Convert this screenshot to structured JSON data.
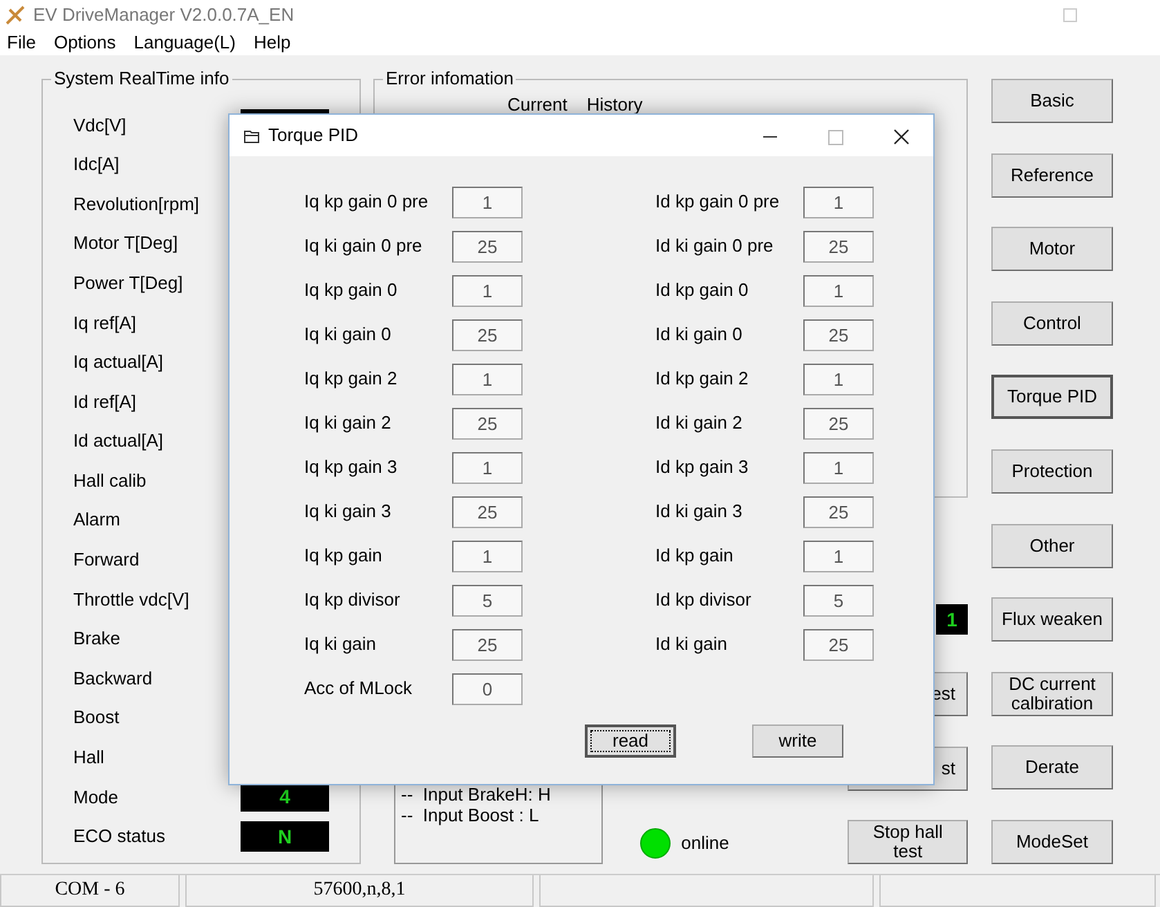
{
  "window": {
    "title": "EV DriveManager V2.0.0.7A_EN"
  },
  "menu": [
    "File",
    "Options",
    "Language(L)",
    "Help"
  ],
  "realtime": {
    "title": "System RealTime info",
    "items": [
      {
        "label": "Vdc[V]",
        "kind": "display"
      },
      {
        "label": "Idc[A]",
        "kind": "plain"
      },
      {
        "label": "Revolution[rpm]",
        "kind": "plain"
      },
      {
        "label": "Motor T[Deg]",
        "kind": "plain"
      },
      {
        "label": "Power T[Deg]",
        "kind": "plain"
      },
      {
        "label": "Iq ref[A]",
        "kind": "plain"
      },
      {
        "label": "Iq actual[A]",
        "kind": "plain"
      },
      {
        "label": "Id ref[A]",
        "kind": "plain"
      },
      {
        "label": "Id actual[A]",
        "kind": "plain"
      },
      {
        "label": "Hall calib",
        "kind": "plain"
      },
      {
        "label": "Alarm",
        "kind": "plain"
      },
      {
        "label": "Forward",
        "kind": "plain"
      },
      {
        "label": "Throttle vdc[V]",
        "kind": "plain"
      },
      {
        "label": "Brake",
        "kind": "plain"
      },
      {
        "label": "Backward",
        "kind": "plain"
      },
      {
        "label": "Boost",
        "kind": "plain"
      },
      {
        "label": "Hall",
        "kind": "plain"
      },
      {
        "label": "Mode",
        "kind": "display",
        "value": "4"
      },
      {
        "label": "ECO status",
        "kind": "display",
        "value": "N"
      }
    ]
  },
  "error_info": {
    "title": "Error infomation",
    "tabs": [
      "Current",
      "History"
    ]
  },
  "input_log": [
    "--  Input BrakeH: H",
    "--  Input Boost : L"
  ],
  "connection": {
    "label": "online",
    "connected": true
  },
  "counter_display": "1",
  "middle_buttons": [
    "est",
    "st",
    "Stop hall test"
  ],
  "side_buttons": [
    {
      "label": "Basic",
      "focused": false
    },
    {
      "label": "Reference",
      "focused": false
    },
    {
      "label": "Motor",
      "focused": false
    },
    {
      "label": "Control",
      "focused": false
    },
    {
      "label": "Torque PID",
      "focused": true
    },
    {
      "label": "Protection",
      "focused": false
    },
    {
      "label": "Other",
      "focused": false
    },
    {
      "label": "Flux weaken",
      "focused": false
    },
    {
      "label": "DC current calbiration",
      "focused": false
    },
    {
      "label": "Derate",
      "focused": false
    },
    {
      "label": "ModeSet",
      "focused": false
    }
  ],
  "status_bar": [
    "COM - 6",
    "57600,n,8,1"
  ],
  "dialog": {
    "title": "Torque PID",
    "iq_fields": [
      {
        "label": "Iq kp gain 0 pre",
        "value": "1"
      },
      {
        "label": "Iq ki gain 0 pre",
        "value": "25"
      },
      {
        "label": "Iq kp gain 0",
        "value": "1"
      },
      {
        "label": "Iq ki gain 0",
        "value": "25"
      },
      {
        "label": "Iq kp gain 2",
        "value": "1"
      },
      {
        "label": "Iq ki gain 2",
        "value": "25"
      },
      {
        "label": "Iq kp gain 3",
        "value": "1"
      },
      {
        "label": "Iq ki gain 3",
        "value": "25"
      },
      {
        "label": "Iq kp gain",
        "value": "1"
      },
      {
        "label": "Iq kp divisor",
        "value": "5"
      },
      {
        "label": "Iq ki gain",
        "value": "25"
      },
      {
        "label": "Acc of MLock",
        "value": "0"
      }
    ],
    "id_fields": [
      {
        "label": "Id kp gain 0 pre",
        "value": "1"
      },
      {
        "label": "Id ki gain 0 pre",
        "value": "25"
      },
      {
        "label": "Id kp gain 0",
        "value": "1"
      },
      {
        "label": "Id ki gain 0",
        "value": "25"
      },
      {
        "label": "Id kp gain 2",
        "value": "1"
      },
      {
        "label": "Id ki gain 2",
        "value": "25"
      },
      {
        "label": "Id kp gain 3",
        "value": "1"
      },
      {
        "label": "Id ki gain 3",
        "value": "25"
      },
      {
        "label": "Id kp gain",
        "value": "1"
      },
      {
        "label": "Id kp divisor",
        "value": "5"
      },
      {
        "label": "Id ki gain",
        "value": "25"
      }
    ],
    "buttons": [
      {
        "label": "read",
        "focused": true
      },
      {
        "label": "write",
        "focused": false
      }
    ]
  }
}
